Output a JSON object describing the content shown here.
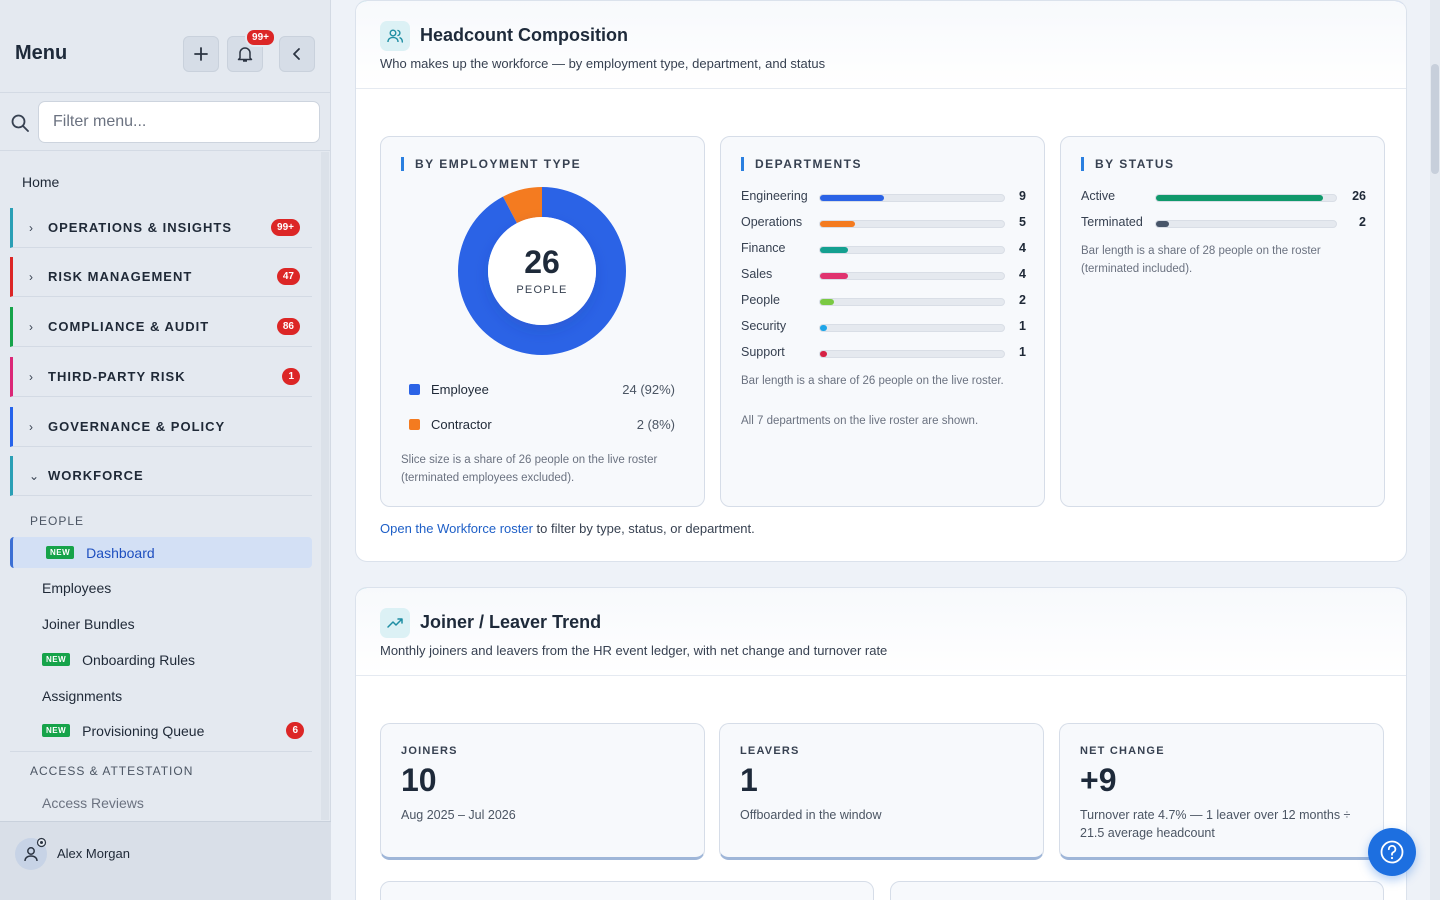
{
  "sidebar": {
    "title": "Menu",
    "bell_badge": "99+",
    "search_placeholder": "Filter menu...",
    "home": "Home",
    "sections": [
      {
        "label": "OPERATIONS & INSIGHTS",
        "badge": "99+",
        "color": "#2a9fb5",
        "chev": "›"
      },
      {
        "label": "RISK MANAGEMENT",
        "badge": "47",
        "color": "#dc2626",
        "chev": "›"
      },
      {
        "label": "COMPLIANCE & AUDIT",
        "badge": "86",
        "color": "#16a34a",
        "chev": "›"
      },
      {
        "label": "THIRD-PARTY RISK",
        "badge": "1",
        "color": "#db2777",
        "chev": "›"
      },
      {
        "label": "GOVERNANCE & POLICY",
        "badge": "",
        "color": "#2563eb",
        "chev": "›"
      },
      {
        "label": "WORKFORCE",
        "badge": "",
        "color": "#2a9fb5",
        "chev": "⌄"
      }
    ],
    "group_people": "PEOPLE",
    "items": [
      {
        "label": "Dashboard",
        "new": "NEW"
      },
      {
        "label": "Employees"
      },
      {
        "label": "Joiner Bundles"
      },
      {
        "label": "Onboarding Rules",
        "new": "NEW"
      },
      {
        "label": "Assignments"
      },
      {
        "label": "Provisioning Queue",
        "new": "NEW",
        "badge": "6"
      }
    ],
    "group_access": "ACCESS & ATTESTATION",
    "access_items": [
      {
        "label": "Access Reviews"
      }
    ],
    "user": "Alex Morgan"
  },
  "headcount": {
    "title": "Headcount Composition",
    "subtitle": "Who makes up the workforce — by employment type, department, and status",
    "employment": {
      "title": "BY EMPLOYMENT TYPE",
      "total": "26",
      "total_label": "PEOPLE",
      "slices": [
        {
          "name": "Employee",
          "value": 24,
          "display": "24 (92%)",
          "color": "#2b63e6"
        },
        {
          "name": "Contractor",
          "value": 2,
          "display": "2 (8%)",
          "color": "#f47b20"
        }
      ],
      "note": "Slice size is a share of 26 people on the live roster (terminated employees excluded)."
    },
    "departments": {
      "title": "DEPARTMENTS",
      "rows": [
        {
          "name": "Engineering",
          "value": 9,
          "display": "9",
          "color": "#2b63e6"
        },
        {
          "name": "Operations",
          "value": 5,
          "display": "5",
          "color": "#f47b20"
        },
        {
          "name": "Finance",
          "value": 4,
          "display": "4",
          "color": "#14a090"
        },
        {
          "name": "Sales",
          "value": 4,
          "display": "4",
          "color": "#e0336f"
        },
        {
          "name": "People",
          "value": 2,
          "display": "2",
          "color": "#7ac943"
        },
        {
          "name": "Security",
          "value": 1,
          "display": "1",
          "color": "#1ea5e8"
        },
        {
          "name": "Support",
          "value": 1,
          "display": "1",
          "color": "#d62043"
        }
      ],
      "scale": 26,
      "note1": "Bar length is a share of 26 people on the live roster.",
      "note2": "All 7 departments on the live roster are shown."
    },
    "status": {
      "title": "BY STATUS",
      "rows": [
        {
          "name": "Active",
          "value": 26,
          "display": "26",
          "color": "#10996b"
        },
        {
          "name": "Terminated",
          "value": 2,
          "display": "2",
          "color": "#475569"
        }
      ],
      "scale": 28,
      "note": "Bar length is a share of 28 people on the roster (terminated included)."
    },
    "link_text": "Open the Workforce roster",
    "link_rest": " to filter by type, status, or department."
  },
  "trend": {
    "title": "Joiner / Leaver Trend",
    "subtitle": "Monthly joiners and leavers from the HR event ledger, with net change and turnover rate",
    "kpis": [
      {
        "label": "JOINERS",
        "value": "10",
        "note": "Aug 2025 – Jul 2026"
      },
      {
        "label": "LEAVERS",
        "value": "1",
        "note": "Offboarded in the window"
      },
      {
        "label": "NET CHANGE",
        "value": "+9",
        "note": "Turnover rate 4.7% — 1 leaver over 12 months ÷ 21.5 average headcount"
      }
    ]
  }
}
